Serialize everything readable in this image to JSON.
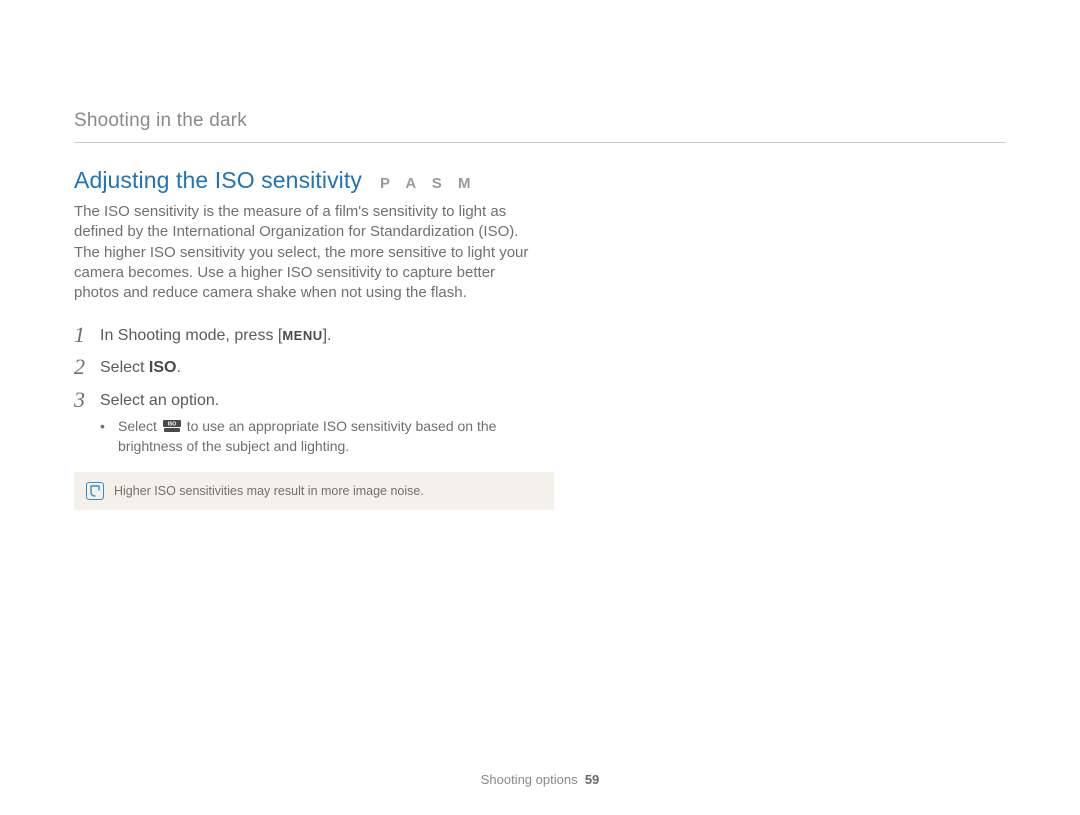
{
  "section_name": "Shooting in the dark",
  "heading": "Adjusting the ISO sensitivity",
  "modes": "P A S M",
  "intro": "The ISO sensitivity is the measure of a film's sensitivity to light as defined by the International Organization for Standardization (ISO). The higher ISO sensitivity you select, the more sensitive to light your camera becomes. Use a higher ISO sensitivity to capture better photos and reduce camera shake when not using the flash.",
  "steps": {
    "s1_num": "1",
    "s1_pre": "In Shooting mode, press [",
    "s1_menu": "MENU",
    "s1_post": "].",
    "s2_num": "2",
    "s2_pre": "Select ",
    "s2_bold": "ISO",
    "s2_post": ".",
    "s3_num": "3",
    "s3_text": "Select an option.",
    "s3_bullet_pre": "Select ",
    "s3_bullet_post": " to use an appropriate ISO sensitivity based on the brightness of the subject and lighting."
  },
  "note": "Higher ISO sensitivities may result in more image noise.",
  "footer_label": "Shooting options",
  "footer_page": "59"
}
